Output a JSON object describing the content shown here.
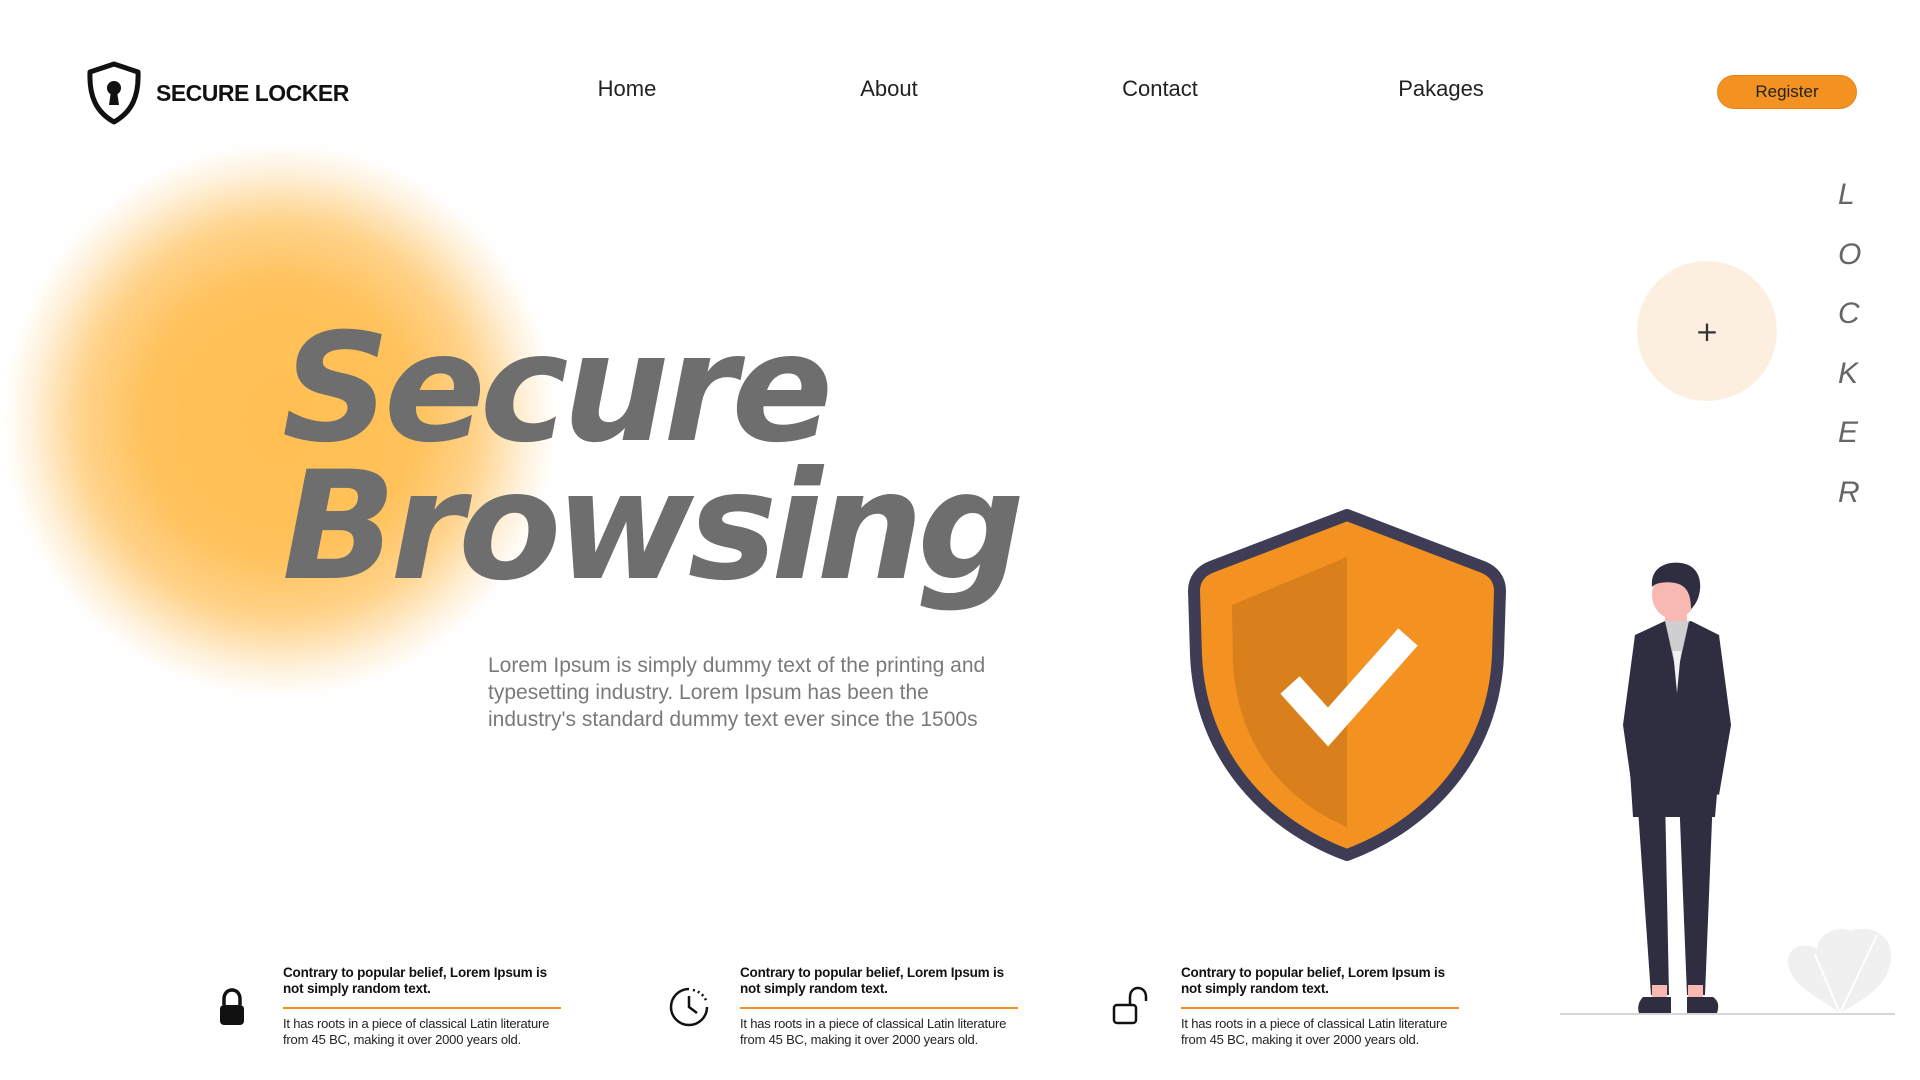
{
  "brand": {
    "name": "SECURE LOCKER",
    "logo_icon": "shield-keyhole-icon"
  },
  "nav": [
    {
      "label": "Home"
    },
    {
      "label": "About"
    },
    {
      "label": "Contact"
    },
    {
      "label": "Pakages"
    }
  ],
  "register": {
    "label": "Register"
  },
  "hero": {
    "line1": "Secure",
    "line2": "Browsing",
    "description": "Lorem Ipsum is simply dummy text of the printing and typesetting industry. Lorem Ipsum has been the industry's standard dummy text ever since the 1500s"
  },
  "vertical_word": [
    "L",
    "O",
    "C",
    "K",
    "E",
    "R"
  ],
  "plus_button": {
    "label": "+"
  },
  "features": [
    {
      "icon": "padlock-closed-icon",
      "title": "Contrary to popular belief, Lorem Ipsum is not simply random text.",
      "text": " It has roots in a piece of classical Latin literature from 45 BC, making it over 2000 years old."
    },
    {
      "icon": "clock-icon",
      "title": "Contrary to popular belief, Lorem Ipsum is not simply random text.",
      "text": " It has roots in a piece of classical Latin literature from 45 BC, making it over 2000 years old."
    },
    {
      "icon": "padlock-open-icon",
      "title": "Contrary to popular belief, Lorem Ipsum is not simply random text.",
      "text": " It has roots in a piece of classical Latin literature from 45 BC, making it over 2000 years old."
    }
  ],
  "colors": {
    "accent": "#f39220",
    "glow": "#ffbf52",
    "shield_dark": "#3f3d56",
    "heading_gray": "#6e6e6e",
    "plus_circle": "#fdefdf"
  }
}
